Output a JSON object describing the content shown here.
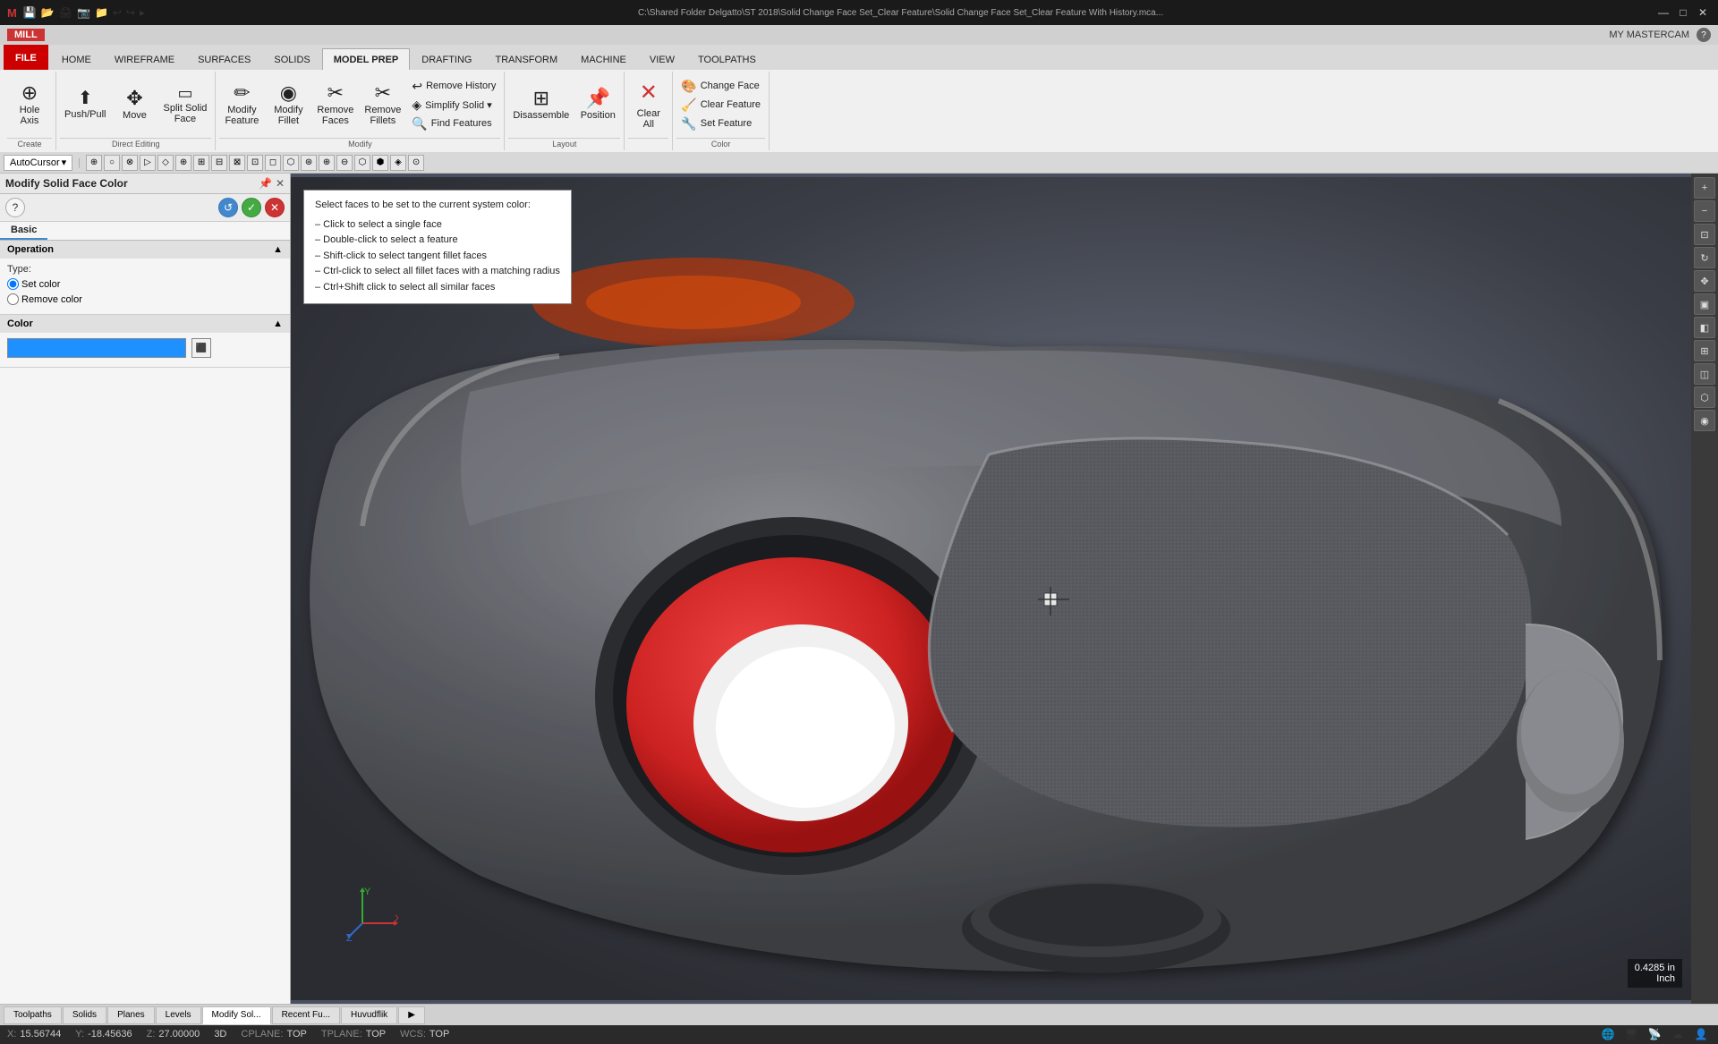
{
  "titlebar": {
    "title": "C:\\Shared Folder Delgatto\\ST 2018\\Solid Change Face Set_Clear Feature\\Solid Change Face Set_Clear Feature With History.mca...",
    "buttons": [
      "—",
      "□",
      "✕"
    ]
  },
  "ribbon_top": {
    "mill_label": "MILL",
    "my_mastercam": "MY MASTERCAM",
    "help_icon": "?"
  },
  "ribbon_tabs": [
    "FILE",
    "HOME",
    "WIREFRAME",
    "SURFACES",
    "SOLIDS",
    "MODEL PREP",
    "DRAFTING",
    "TRANSFORM",
    "MACHINE",
    "VIEW",
    "TOOLPATHS"
  ],
  "active_tab": "MODEL PREP",
  "ribbon_groups": {
    "create": {
      "label": "Create",
      "buttons": [
        {
          "label": "Hole Axis",
          "icon": "⊕"
        }
      ]
    },
    "direct_editing": {
      "label": "Direct Editing",
      "buttons": [
        {
          "label": "Push/Pull",
          "icon": "⬆"
        },
        {
          "label": "Move",
          "icon": "✥"
        },
        {
          "label": "Split Solid Face",
          "icon": "▭"
        }
      ]
    },
    "modify": {
      "label": "Modify",
      "small_buttons": [
        {
          "label": "Remove History",
          "icon": "↩"
        },
        {
          "label": "Simplify Solid ▾",
          "icon": "◈"
        },
        {
          "label": "Find Features",
          "icon": "🔍"
        }
      ],
      "buttons": [
        {
          "label": "Modify Feature",
          "icon": "✏"
        },
        {
          "label": "Modify Fillet",
          "icon": "◉"
        },
        {
          "label": "Remove Faces",
          "icon": "✂"
        },
        {
          "label": "Remove Fillets",
          "icon": "✂"
        }
      ]
    },
    "layout": {
      "label": "Layout",
      "buttons": [
        {
          "label": "Disassemble",
          "icon": "⊞"
        },
        {
          "label": "Position",
          "icon": "📌"
        }
      ]
    },
    "clear_all": {
      "label": "Clear All",
      "icon": "✕"
    },
    "color": {
      "label": "Color",
      "buttons": [
        {
          "label": "Change Face",
          "icon": "🎨"
        },
        {
          "label": "Clear Feature",
          "icon": "🧹"
        },
        {
          "label": "Set Feature",
          "icon": "🔧"
        }
      ]
    }
  },
  "autocursor_bar": {
    "dropdown_label": "AutoCursor",
    "buttons": [
      "⊕",
      "○",
      "⊗",
      "▷",
      "◈",
      "⊕",
      "⊞",
      "⊟",
      "⊠",
      "⊡",
      "◻",
      "⬡",
      "⊛",
      "⊕",
      "⊖",
      "⬡",
      "⬢",
      "◈",
      "⊙"
    ]
  },
  "panel": {
    "title": "Modify Solid Face Color",
    "tabs": [
      "Basic"
    ],
    "sections": {
      "operation": {
        "header": "Operation",
        "type_label": "Type:",
        "options": [
          "Set color",
          "Remove color"
        ],
        "selected": "Set color"
      },
      "color": {
        "header": "Color",
        "color_value": "#1e90ff"
      }
    }
  },
  "tooltip": {
    "header": "Select faces to be set to the current system color:",
    "lines": [
      "– Click to select a single face",
      "– Double-click to select a feature",
      "– Shift-click to select tangent fillet faces",
      "– Ctrl-click to select all fillet faces with a matching radius",
      "– Ctrl+Shift click to select all similar faces"
    ]
  },
  "bottom_tabs": [
    "Toolpaths",
    "Solids",
    "Planes",
    "Levels",
    "Modify Sol...",
    "Recent Fu...",
    "Huvudflik",
    "▶"
  ],
  "active_bottom_tab": "Modify Sol...",
  "status_bar": {
    "x_label": "X:",
    "x_value": "15.56744",
    "y_label": "Y:",
    "y_value": "-18.45636",
    "z_label": "Z:",
    "z_value": "27.00000",
    "mode": "3D",
    "cplane_label": "CPLANE:",
    "cplane_value": "TOP",
    "tplane_label": "TPLANE:",
    "tplane_value": "TOP",
    "wcs_label": "WCS:",
    "wcs_value": "TOP"
  },
  "scale_indicator": {
    "value": "0.4285 in",
    "unit": "Inch"
  },
  "quick_access": [
    "💾",
    "📂",
    "💾",
    "🖨",
    "📷",
    "📁",
    "↩",
    "↪",
    "▸"
  ]
}
